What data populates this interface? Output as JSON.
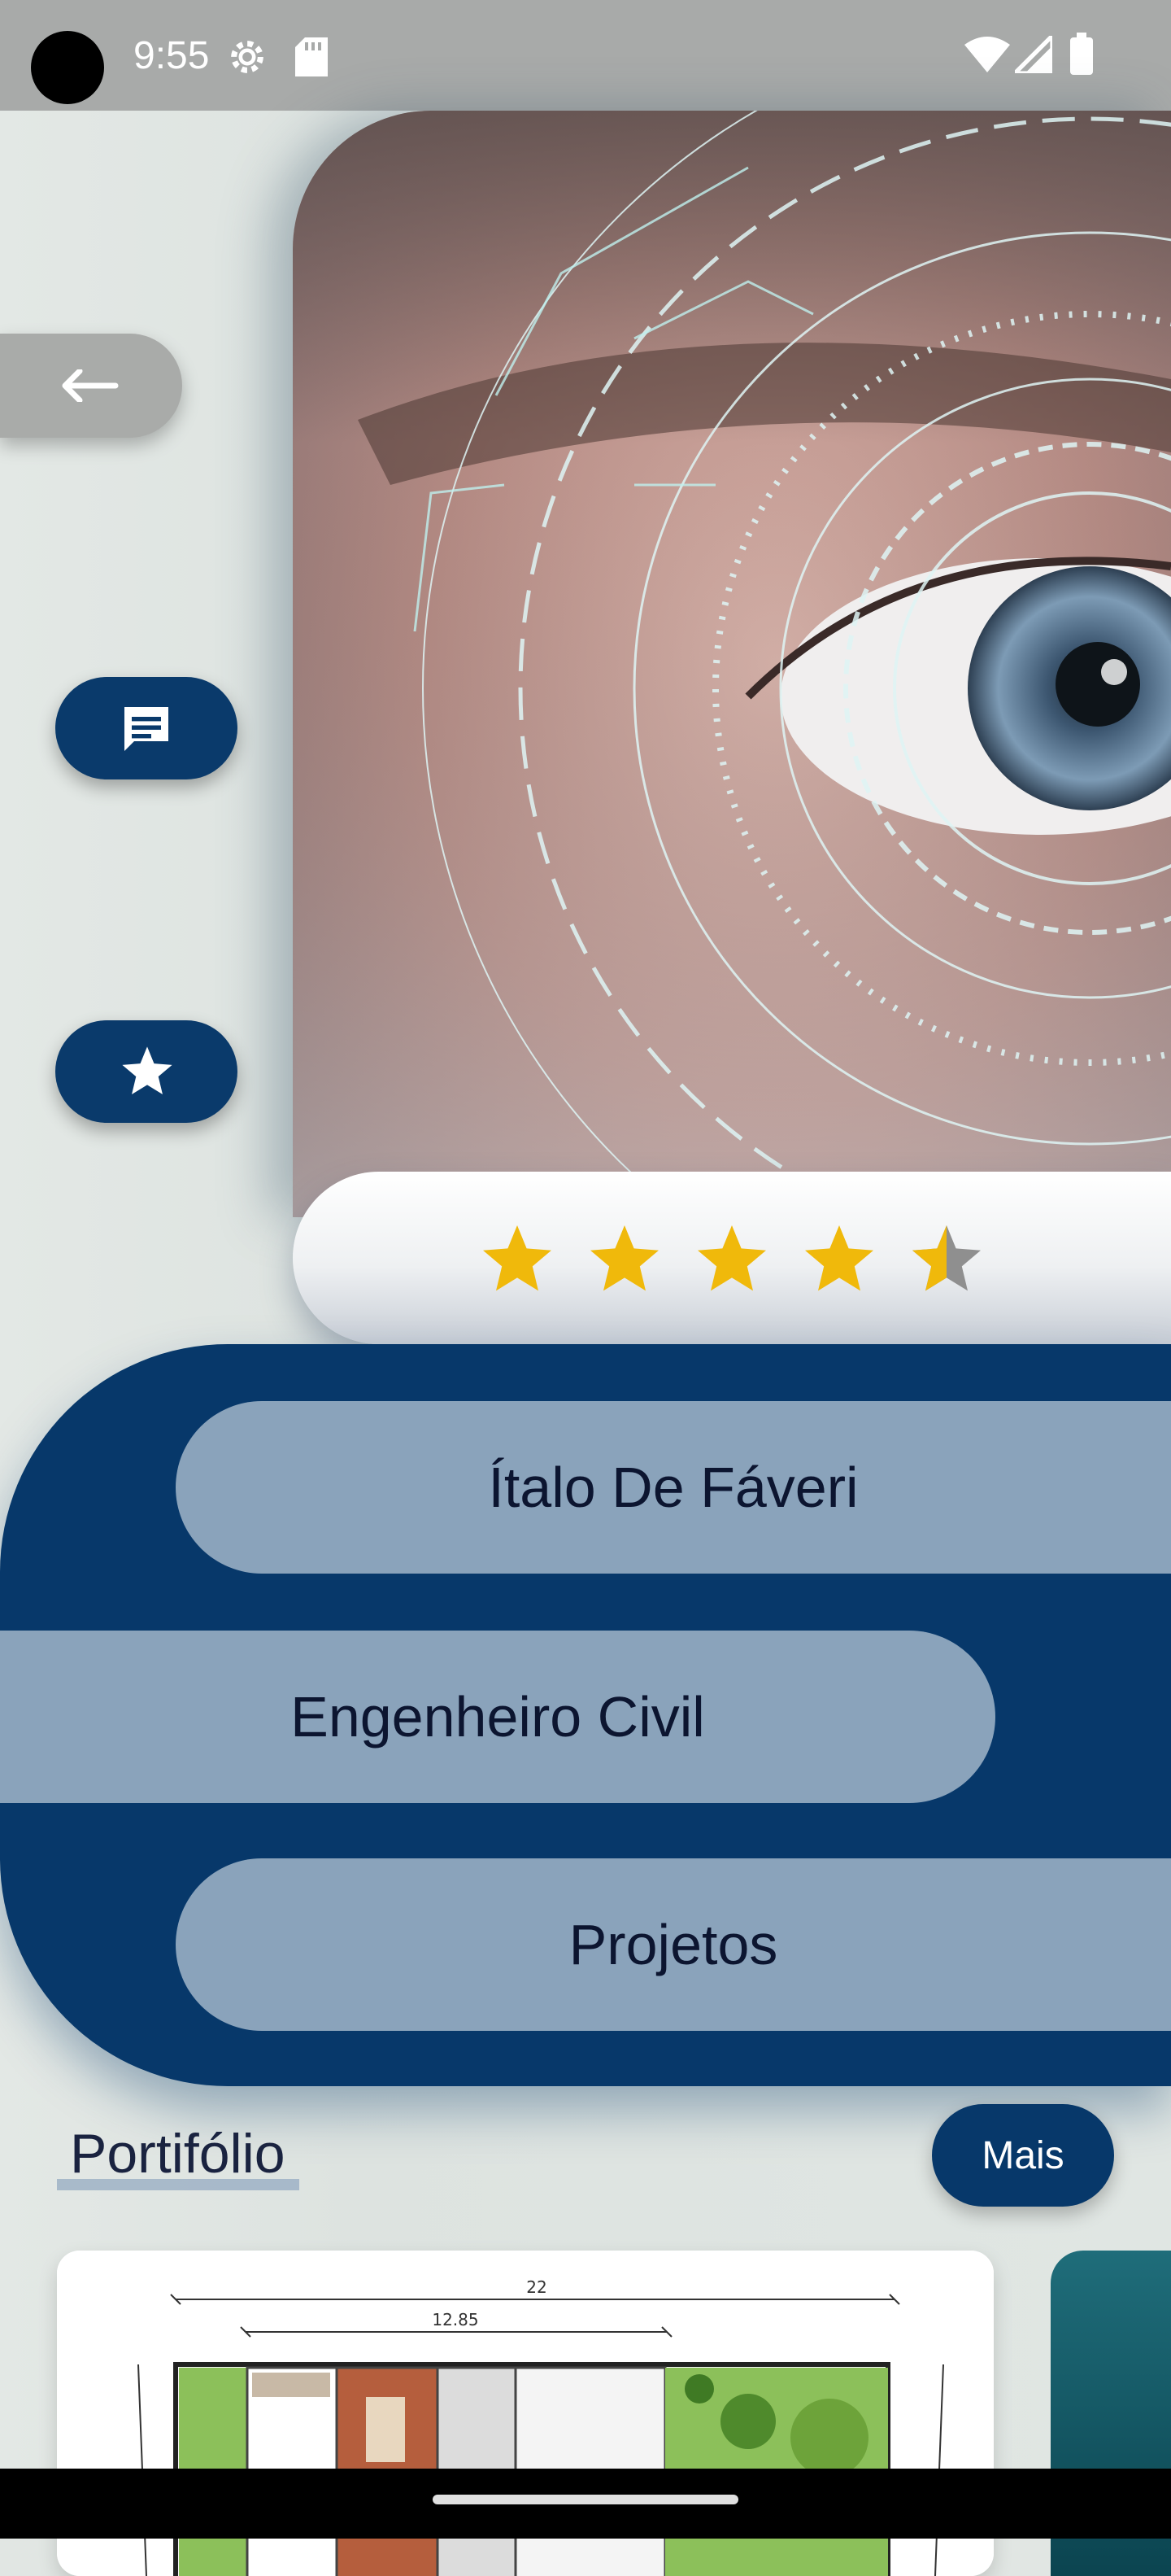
{
  "status_bar": {
    "time": "9:55",
    "icons": [
      "gear-icon",
      "sd-card-icon",
      "wifi-icon",
      "signal-icon",
      "battery-icon"
    ]
  },
  "hero": {
    "image": "eye-biometric-scan-image"
  },
  "side_buttons": {
    "back_icon": "arrow-left-icon",
    "message_icon": "chat-icon",
    "favorite_icon": "star-icon"
  },
  "rating": {
    "value": 4.5,
    "max": 5,
    "filled_color": "#f0b90b",
    "empty_color": "#8f8f8f"
  },
  "profile": {
    "name": "Ítalo De Fáveri",
    "role": "Engenheiro Civil",
    "projects_label": "Projetos"
  },
  "portfolio": {
    "title": "Portifólio",
    "more_label": "Mais",
    "floorplan_dim_total": "22",
    "floorplan_dim_partial": "12.85"
  },
  "colors": {
    "primary": "#07386a",
    "pill": "#8aa3bb",
    "status_bar": "#a8aaa9"
  }
}
